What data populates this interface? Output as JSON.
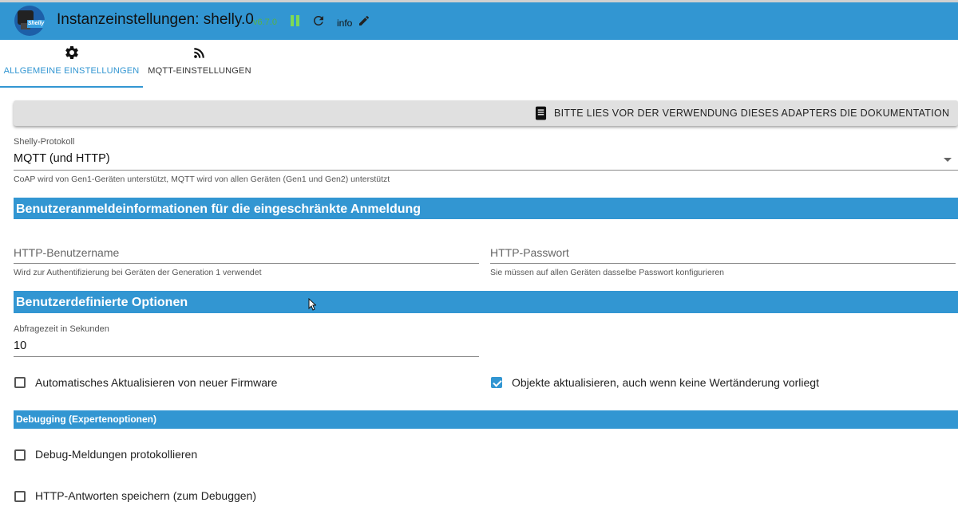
{
  "header": {
    "title": "Instanzeinstellungen: shelly.0",
    "version": "v6.7.0",
    "info_label": "info",
    "logo_text": "Shelly",
    "accent_color": "#3296d2"
  },
  "tabs": [
    {
      "label": "ALLGEMEINE EINSTELLUNGEN",
      "icon": "gear-icon",
      "active": true
    },
    {
      "label": "MQTT-EINSTELLUNGEN",
      "icon": "rss-feed-icon",
      "active": false
    }
  ],
  "doc_button": {
    "label": "BITTE LIES VOR DER VERWENDUNG DIESES ADAPTERS DIE DOKUMENTATION",
    "icon": "book-icon"
  },
  "protocol": {
    "label": "Shelly-Protokoll",
    "value": "MQTT (und HTTP)",
    "help": "CoAP wird von Gen1-Geräten unterstützt, MQTT wird von allen Geräten (Gen1 und Gen2) unterstützt"
  },
  "section_credentials": {
    "title": "Benutzeranmeldeinformationen für die eingeschränkte Anmeldung"
  },
  "http_user": {
    "placeholder": "HTTP-Benutzername",
    "help": "Wird zur Authentifizierung bei Geräten der Generation 1 verwendet"
  },
  "http_password": {
    "placeholder": "HTTP-Passwort",
    "help": "Sie müssen auf allen Geräten dasselbe Passwort konfigurieren"
  },
  "section_custom": {
    "title": "Benutzerdefinierte Optionen"
  },
  "poll_interval": {
    "label": "Abfragezeit in Sekunden",
    "value": "10"
  },
  "checkboxes": {
    "auto_update": {
      "label": "Automatisches Aktualisieren von neuer Firmware",
      "checked": false
    },
    "update_objects": {
      "label": "Objekte aktualisieren, auch wenn keine Wertänderung vorliegt",
      "checked": true
    },
    "debug_log": {
      "label": "Debug-Meldungen protokollieren",
      "checked": false
    },
    "save_http": {
      "label": "HTTP-Antworten speichern (zum Debuggen)",
      "checked": false
    }
  },
  "section_debug": {
    "title": "Debugging (Expertenoptionen)"
  }
}
